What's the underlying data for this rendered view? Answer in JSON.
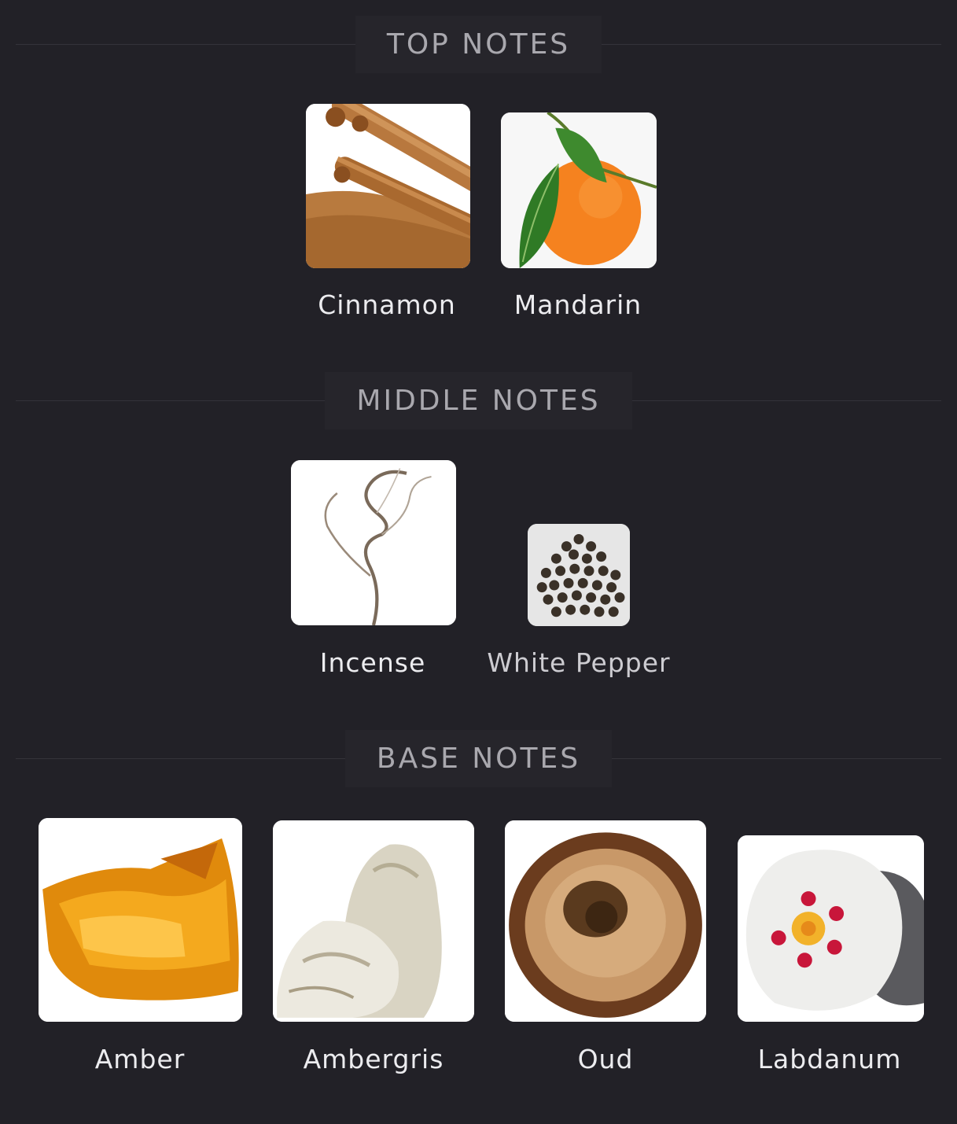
{
  "sections": [
    {
      "title": "TOP NOTES",
      "notes": [
        {
          "label": "Cinnamon",
          "icon": "cinnamon-icon"
        },
        {
          "label": "Mandarin",
          "icon": "mandarin-icon"
        }
      ]
    },
    {
      "title": "MIDDLE NOTES",
      "notes": [
        {
          "label": "Incense",
          "icon": "incense-icon"
        },
        {
          "label": "White Pepper",
          "icon": "white-pepper-icon"
        }
      ]
    },
    {
      "title": "BASE NOTES",
      "notes": [
        {
          "label": "Amber",
          "icon": "amber-icon"
        },
        {
          "label": "Ambergris",
          "icon": "ambergris-icon"
        },
        {
          "label": "Oud",
          "icon": "oud-icon"
        },
        {
          "label": "Labdanum",
          "icon": "labdanum-icon"
        }
      ]
    }
  ],
  "colors": {
    "background": "#222127",
    "header_text": "#a9a8ae",
    "label_text": "#ececef"
  }
}
